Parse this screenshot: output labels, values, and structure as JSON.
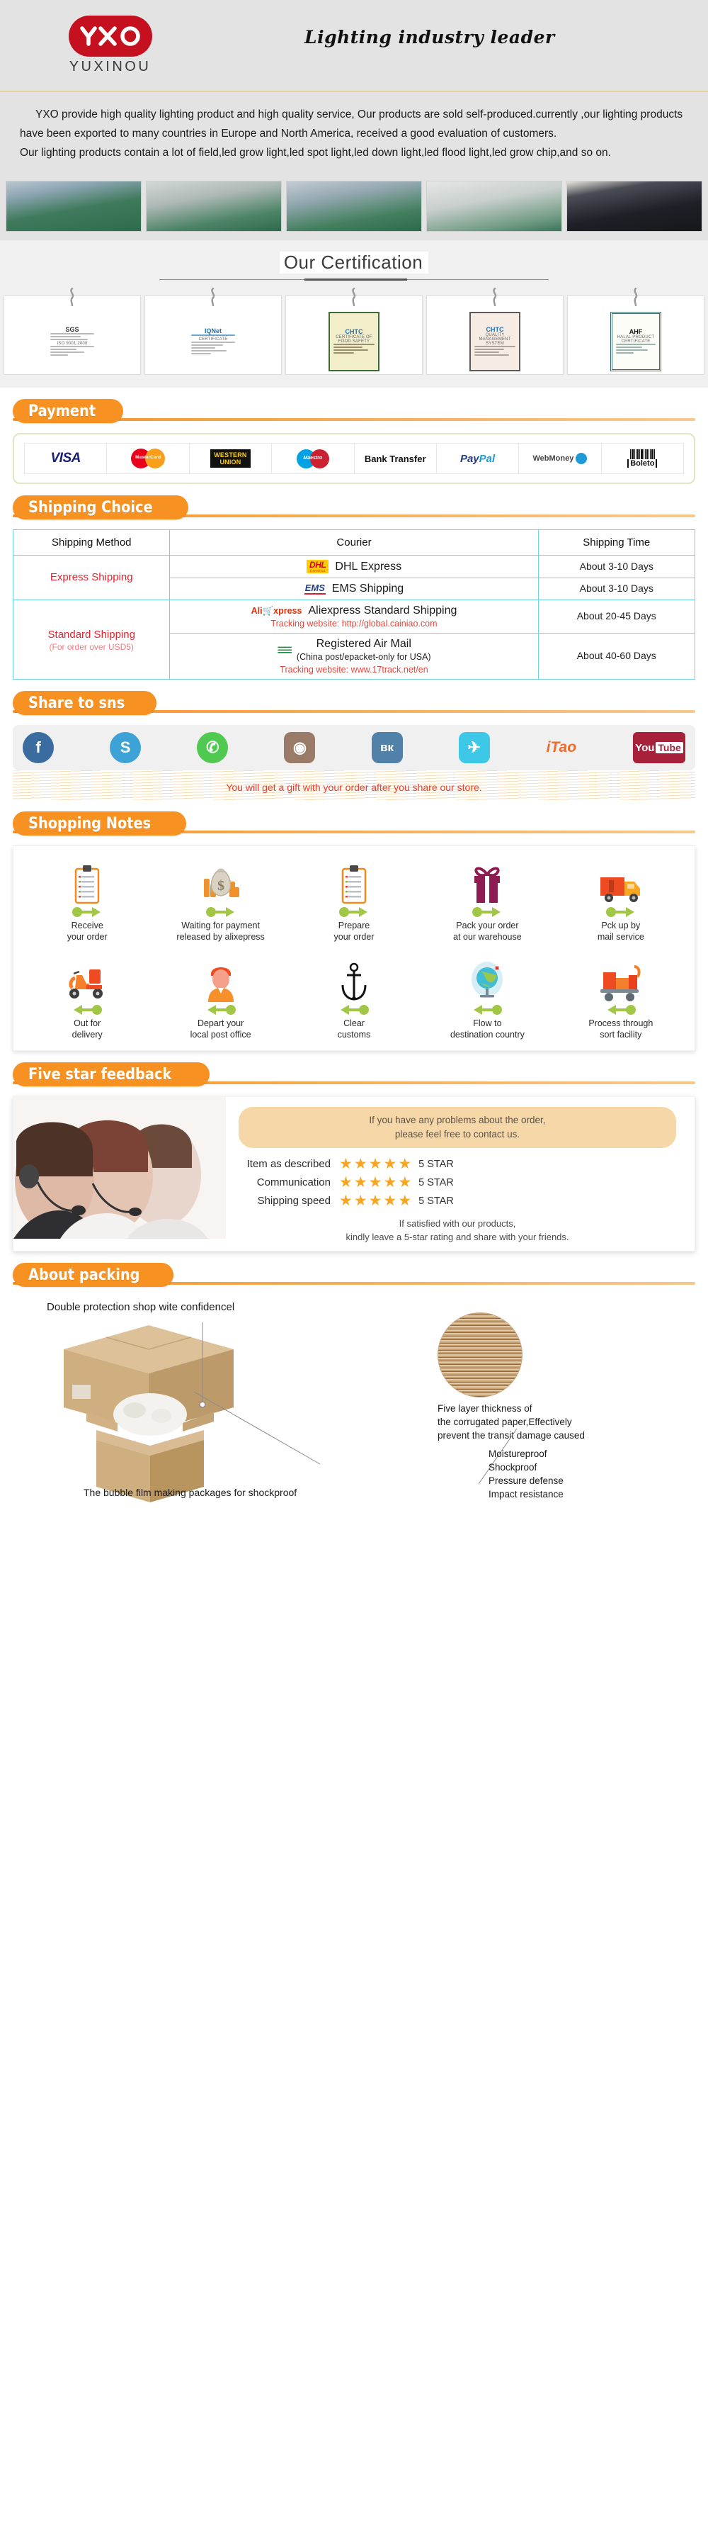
{
  "header": {
    "logo_text": "YXO",
    "logo_sub": "YUXINOU",
    "slogan": "Lighting industry leader"
  },
  "intro": {
    "line1": "YXO provide high quality lighting product and high quality service, Our products are sold self-produced.currently ,our lighting products have been exported to many countries in Europe and North America, received a good evaluation of customers.",
    "line2": "Our lighting products contain a lot of field,led grow light,led spot light,led down light,led flood light,led grow chip,and so on."
  },
  "factory": {
    "photos": [
      {
        "alt": "assembly-line-workers"
      },
      {
        "alt": "testing-chamber-equipment"
      },
      {
        "alt": "smt-production-machine"
      },
      {
        "alt": "quality-inspection-station"
      },
      {
        "alt": "product-showroom-display"
      }
    ]
  },
  "certification": {
    "title": "Our Certification",
    "items": [
      {
        "name": "SGS ISO 9001:2008 Certificate",
        "brand": "SGS",
        "label": "ISO 9001:2008",
        "style": "sgs"
      },
      {
        "name": "IQNet Certificate",
        "brand": "IQNet",
        "label": "CERTIFICATE",
        "style": "plain"
      },
      {
        "name": "CHTC Food Safety Management System Certification",
        "brand": "CHTC",
        "label": "CERTIFICATE OF FOOD SAFETY",
        "style": "yellow"
      },
      {
        "name": "CHTC Quality Management System Certificate",
        "brand": "CHTC",
        "label": "QUALITY MANAGEMENT SYSTEM",
        "style": "pink"
      },
      {
        "name": "Halal Product Certificate",
        "brand": "AHF",
        "label": "HALAL PRODUCT CERTIFICATE",
        "style": "green"
      }
    ]
  },
  "payment": {
    "banner": "Payment",
    "methods": [
      {
        "name": "VISA",
        "icon": "visa-logo"
      },
      {
        "name": "MasterCard",
        "icon": "mastercard-logo"
      },
      {
        "name": "WESTERN UNION",
        "icon": "western-union-logo",
        "line1": "WESTERN",
        "line2": "UNION"
      },
      {
        "name": "Maestro",
        "icon": "maestro-logo"
      },
      {
        "name": "Bank Transfer",
        "icon": "bank-transfer-logo"
      },
      {
        "name": "PayPal",
        "icon": "paypal-logo",
        "pp1": "Pay",
        "pp2": "Pal"
      },
      {
        "name": "WebMoney",
        "icon": "webmoney-logo"
      },
      {
        "name": "Boleto",
        "icon": "boleto-logo"
      }
    ]
  },
  "shipping": {
    "banner": "Shipping Choice",
    "headers": [
      "Shipping Method",
      "Courier",
      "Shipping Time"
    ],
    "groups": [
      {
        "method": "Express Shipping",
        "method_sub": "",
        "rows": [
          {
            "logo": "dhl-logo",
            "courier": "DHL Express",
            "courier_sub": "",
            "tracking": "",
            "time": "About 3-10 Days"
          },
          {
            "logo": "ems-logo",
            "courier": "EMS Shipping",
            "courier_sub": "",
            "tracking": "",
            "time": "About 3-10 Days"
          }
        ]
      },
      {
        "method": "Standard Shipping",
        "method_sub": "(For order over USD5)",
        "rows": [
          {
            "logo": "aliexpress-logo",
            "courier": "Aliexpress Standard Shipping",
            "courier_sub": "",
            "tracking": "Tracking website: http://global.cainiao.com",
            "time": "About 20-45 Days"
          },
          {
            "logo": "air-mail-logo",
            "courier": "Registered Air Mail",
            "courier_sub": "(China post/epacket-only for USA)",
            "tracking": "Tracking website: www.17track.net/en",
            "time": "About 40-60 Days"
          }
        ]
      }
    ]
  },
  "share": {
    "banner": "Share to sns",
    "networks": [
      {
        "name": "Facebook",
        "icon": "facebook-icon",
        "glyph": "f",
        "color": "#3b6ca0",
        "shape": "circle"
      },
      {
        "name": "Skype",
        "icon": "skype-icon",
        "glyph": "S",
        "color": "#3da3d6",
        "shape": "circle"
      },
      {
        "name": "WhatsApp",
        "icon": "whatsapp-icon",
        "glyph": "✆",
        "color": "#4fc94f",
        "shape": "circle"
      },
      {
        "name": "Instagram",
        "icon": "instagram-icon",
        "glyph": "◉",
        "color": "#9a7b68",
        "shape": "square"
      },
      {
        "name": "VK",
        "icon": "vk-icon",
        "glyph": "вк",
        "color": "#5181a8",
        "shape": "square"
      },
      {
        "name": "Twitter",
        "icon": "twitter-icon",
        "glyph": "✈",
        "color": "#3ec8e8",
        "shape": "square"
      },
      {
        "name": "iTao",
        "icon": "itao-icon",
        "glyph": "iTao",
        "color": "#f06a2a",
        "shape": "none"
      },
      {
        "name": "YouTube",
        "icon": "youtube-icon",
        "glyph": "You",
        "color": "#a8213a",
        "shape": "none"
      }
    ],
    "gift_note": "You will get a gift with your order after you share our store."
  },
  "shopping_notes": {
    "banner": "Shopping Notes",
    "row1": [
      {
        "icon": "clipboard-icon",
        "label_line1": "Receive",
        "label_line2": "your order",
        "arrow": "right"
      },
      {
        "icon": "money-bag-icon",
        "label_line1": "Waiting for payment",
        "label_line2": "released by alixepress",
        "arrow": "right"
      },
      {
        "icon": "clipboard-icon",
        "label_line1": "Prepare",
        "label_line2": "your order",
        "arrow": "right"
      },
      {
        "icon": "gift-box-icon",
        "label_line1": "Pack your order",
        "label_line2": "at our warehouse",
        "arrow": "right"
      },
      {
        "icon": "delivery-truck-icon",
        "label_line1": "Pck up by",
        "label_line2": "mail service",
        "arrow": "right"
      }
    ],
    "row2": [
      {
        "icon": "scooter-icon",
        "label_line1": "Out for",
        "label_line2": "delivery",
        "arrow": "left"
      },
      {
        "icon": "postman-icon",
        "label_line1": "Depart your",
        "label_line2": "local post office",
        "arrow": "left"
      },
      {
        "icon": "anchor-icon",
        "label_line1": "Clear",
        "label_line2": "customs",
        "arrow": "left"
      },
      {
        "icon": "globe-icon",
        "label_line1": "Flow to",
        "label_line2": "destination country",
        "arrow": "left"
      },
      {
        "icon": "cart-boxes-icon",
        "label_line1": "Process through",
        "label_line2": "sort facility",
        "arrow": "left"
      }
    ]
  },
  "feedback": {
    "banner": "Five star feedback",
    "bubble_line1": "If you have any problems about the order,",
    "bubble_line2": "please feel free to contact us.",
    "ratings": [
      {
        "label": "Item as described",
        "stars": 5,
        "value": "5 STAR"
      },
      {
        "label": "Communication",
        "stars": 5,
        "value": "5 STAR"
      },
      {
        "label": "Shipping speed",
        "stars": 5,
        "value": "5 STAR"
      }
    ],
    "foot_line1": "If satisfied with our products,",
    "foot_line2": "kindly leave a 5-star rating and share with your friends."
  },
  "packing": {
    "banner": "About packing",
    "title": "Double protection shop wite confidencel",
    "corrugated_text": "Five layer thickness of\nthe corrugated paper,Effectively\nprevent the transit damage caused",
    "features": [
      "Moistureproof",
      "Shockproof",
      "Pressure defense",
      "Impact resistance"
    ],
    "caption": "The bubble film making packages for shockproof"
  },
  "colors": {
    "brand_red": "#c4101f",
    "accent_orange": "#f79122",
    "table_border": "#6fd3e8",
    "tracking_red": "#e8453c",
    "star_gold": "#f6a623"
  }
}
